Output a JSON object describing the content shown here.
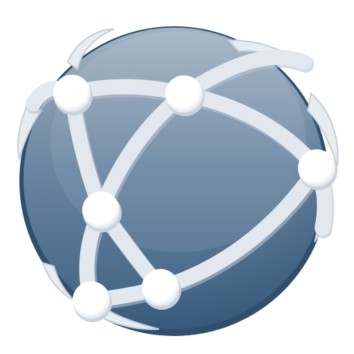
{
  "icon": {
    "name": "network-globe-icon",
    "colors": {
      "sphere_light": "#a3b4c4",
      "sphere_mid": "#6b87a3",
      "sphere_dark": "#3c5f80",
      "sphere_edge": "#2f4f6d",
      "link_fill": "#e3e8ee",
      "link_shadow": "#b7c3cf",
      "node_fill": "#ffffff",
      "node_shadow": "#c9d2db"
    },
    "node_count": 6,
    "link_count": 8
  }
}
